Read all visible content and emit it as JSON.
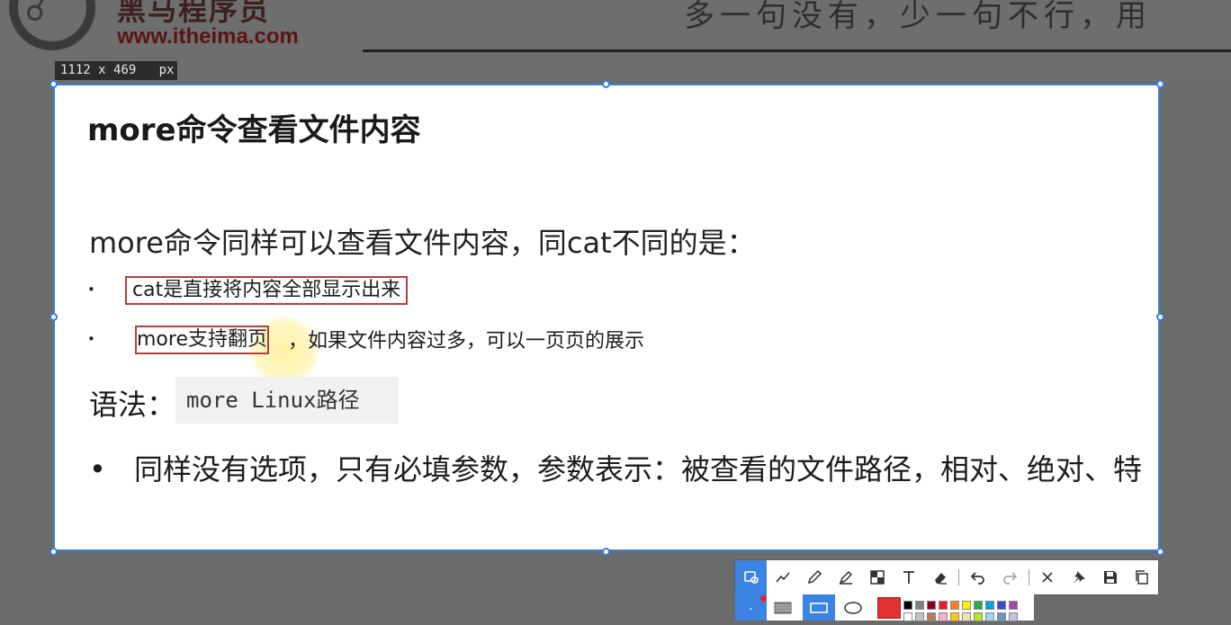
{
  "background": {
    "logo_text": "黑马程序员",
    "logo_url": "www.itheima.com",
    "slogan": "多一句没有，少一句不行，用"
  },
  "capture": {
    "size_label": "1112 x 469   px"
  },
  "slide": {
    "title": "more命令查看文件内容",
    "intro": "more命令同样可以查看文件内容，同cat不同的是：",
    "bullet1": "cat是直接将内容全部显示出来",
    "bullet2_highlight": "more支持翻页",
    "bullet2_rest": "，如果文件内容过多，可以一页页的展示",
    "syntax_label": "语法：",
    "syntax_code": "more Linux路径",
    "bullet3": "同样没有选项，只有必填参数，参数表示：被查看的文件路径，相对、绝对、特"
  },
  "toolbar": {
    "tools": [
      "rectangle-select-icon",
      "polyline-icon",
      "pencil-icon",
      "marker-icon",
      "mosaic-icon",
      "text-icon",
      "eraser-icon",
      "undo-icon",
      "redo-icon",
      "close-icon",
      "pin-icon",
      "save-icon",
      "copy-icon"
    ],
    "active_tool": "rectangle-select-icon",
    "accent": "#3b84e3",
    "selected_color": "#e03030",
    "palette": [
      "#000000",
      "#7f7f7f",
      "#880015",
      "#ed1c24",
      "#ff7f27",
      "#fff200",
      "#22b14c",
      "#00a2e8",
      "#3f48cc",
      "#a349a4",
      "#ffffff",
      "#c3c3c3",
      "#b97a57",
      "#ffaec9",
      "#ffc90e",
      "#efe4b0",
      "#b5e61d",
      "#99d9ea",
      "#7092be",
      "#c8bfe7"
    ]
  }
}
